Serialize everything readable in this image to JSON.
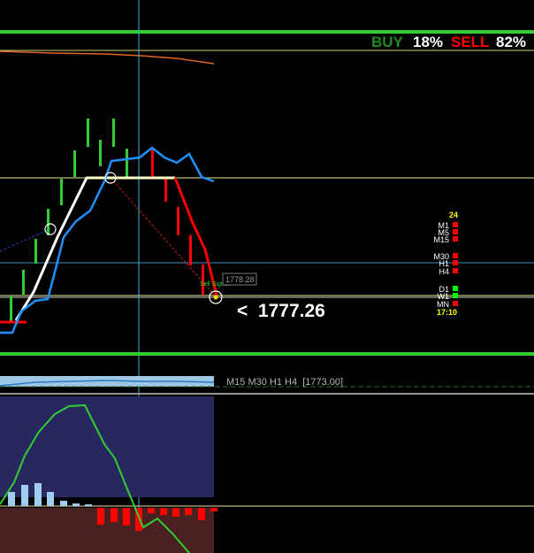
{
  "sentiment": {
    "buy_label": "BUY",
    "buy_value": "18%",
    "sell_label": "SELL",
    "sell_value": "82%",
    "buy_color": "#1e8c1e",
    "sell_color": "#ff0000"
  },
  "price": {
    "current": "<  1777.26",
    "tag": "1778.28",
    "annotation": "Sell Signal"
  },
  "timeframes": {
    "counter_top": "24",
    "time": "17:10",
    "items": [
      {
        "label": "M1",
        "color": "#ff0000"
      },
      {
        "label": "M5",
        "color": "#ff0000"
      },
      {
        "label": "M15",
        "color": "#ff0000"
      },
      {
        "label": "M30",
        "color": "#ff0000"
      },
      {
        "label": "H1",
        "color": "#ff0000"
      },
      {
        "label": "H4",
        "color": "#ff0000"
      },
      {
        "label": "D1",
        "color": "#00ff00"
      },
      {
        "label": "W1",
        "color": "#00ff00"
      },
      {
        "label": "MN",
        "color": "#ff0000"
      }
    ]
  },
  "subwindow": {
    "label": "M15 M30 H1 H4  [1773.00]"
  },
  "colors": {
    "background": "#000000",
    "frame_green": "#32cd32",
    "hline_yellow": "#e6e68c",
    "hline_cyan": "#3c8cbe",
    "vline": "#3cb4dc",
    "bull_candle": "#32cd32",
    "bear_candle": "#ff0000",
    "ma_blue": "#1e90ff",
    "oscillator_green": "#32cd32"
  }
}
